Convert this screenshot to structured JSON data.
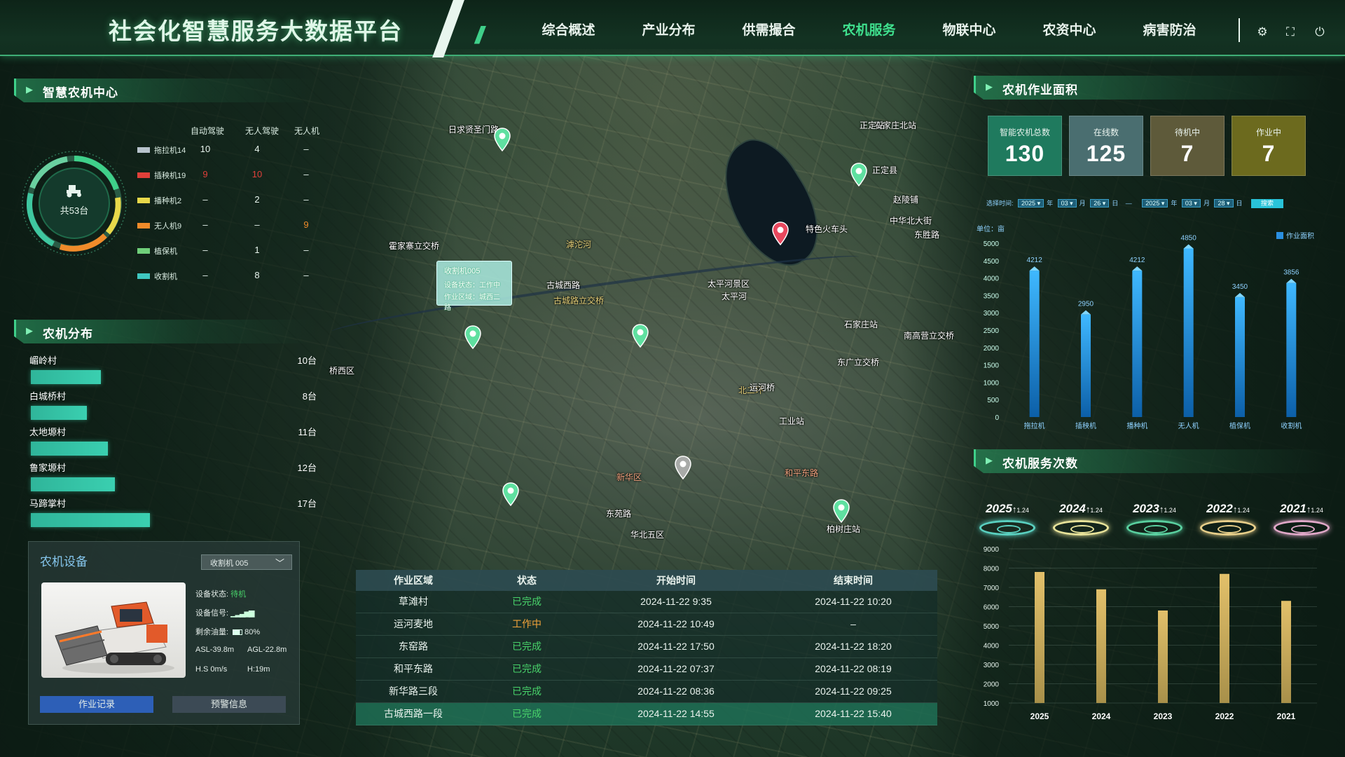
{
  "header": {
    "title": "社会化智慧服务大数据平台",
    "slashes": "//",
    "nav": [
      "综合概述",
      "产业分布",
      "供需撮合",
      "农机服务",
      "物联中心",
      "农资中心",
      "病害防治"
    ],
    "active_index": 3
  },
  "map": {
    "labels": [
      "日求贤圣门路",
      "石家庄北站",
      "石家庄站",
      "新华区",
      "太平河景区",
      "特色火车头",
      "和平东路",
      "北二环",
      "桥西区",
      "工业站",
      "运河桥",
      "东胜路",
      "太平河",
      "华北五区",
      "东广立交桥",
      "霍家寨立交桥",
      "南高营立交桥",
      "正定县",
      "正定站",
      "柏树庄站",
      "古城西路",
      "古城路立交桥",
      "滹沱河",
      "东苑路",
      "中华北大街",
      "赵陵铺"
    ],
    "popup": {
      "title": "收割机005",
      "status_label": "设备状态：",
      "status_value": "工作中",
      "area_label": "作业区域：",
      "area_value": "城西二路"
    }
  },
  "left": {
    "center_title": "智慧农机中心",
    "gauge_total": "共53台",
    "machine_headers": [
      "自动驾驶",
      "无人驾驶",
      "无人机"
    ],
    "machines": [
      {
        "name": "拖拉机14",
        "color": "#b7c3cc",
        "vals": [
          "10",
          "4",
          "–"
        ]
      },
      {
        "name": "插秧机19",
        "color": "#e0403a",
        "vals": [
          "9",
          "10",
          "–"
        ]
      },
      {
        "name": "播种机2",
        "color": "#e8d84a",
        "vals": [
          "–",
          "2",
          "–"
        ]
      },
      {
        "name": "无人机9",
        "color": "#f08b2a",
        "vals": [
          "–",
          "–",
          "9"
        ]
      },
      {
        "name": "植保机",
        "color": "#6fcf7a",
        "vals": [
          "–",
          "1",
          "–"
        ]
      },
      {
        "name": "收割机",
        "color": "#3fc7c0",
        "vals": [
          "–",
          "8",
          "–"
        ]
      }
    ],
    "dist_title": "农机分布",
    "distribution": [
      {
        "name": "嵋岭村",
        "count": "10台",
        "value": 10
      },
      {
        "name": "白城桥村",
        "count": "8台",
        "value": 8
      },
      {
        "name": "太地塬村",
        "count": "11台",
        "value": 11
      },
      {
        "name": "鲁家塬村",
        "count": "12台",
        "value": 12
      },
      {
        "name": "马蹄掌村",
        "count": "17台",
        "value": 17
      }
    ],
    "device": {
      "title": "农机设备",
      "select": "收割机 005",
      "status_label": "设备状态:",
      "status_value": "待机",
      "signal_label": "设备信号:",
      "fuel_label": "剩余油量:",
      "fuel_value": "80%",
      "asl": "ASL-39.8m",
      "agl": "AGL-22.8m",
      "hs": "H.S 0m/s",
      "h": "H:19m",
      "btn_record": "作业记录",
      "btn_warn": "预警信息"
    }
  },
  "right": {
    "area_title": "农机作业面积",
    "stats": [
      {
        "label": "智能农机总数",
        "value": "130",
        "color": "#1f7a5e"
      },
      {
        "label": "在线数",
        "value": "125",
        "color": "#4a6e70"
      },
      {
        "label": "待机中",
        "value": "7",
        "color": "#5e5a3a"
      },
      {
        "label": "作业中",
        "value": "7",
        "color": "#6c6a1e"
      }
    ],
    "filter": {
      "label": "选择时间:",
      "y1": "2025",
      "m1": "03",
      "d1": "26",
      "y2": "2025",
      "m2": "03",
      "d2": "28",
      "year": "年",
      "month": "月",
      "day": "日",
      "dash": "—",
      "search": "搜索"
    },
    "service_title": "农机服务次数",
    "years": [
      {
        "year": "2025",
        "delta": "1.24",
        "color": "#5ad0c0"
      },
      {
        "year": "2024",
        "delta": "1.24",
        "color": "#e8e39a"
      },
      {
        "year": "2023",
        "delta": "1.24",
        "color": "#5ad0a0"
      },
      {
        "year": "2022",
        "delta": "1.24",
        "color": "#e8cf8a"
      },
      {
        "year": "2021",
        "delta": "1.24",
        "color": "#e0a8c8"
      }
    ]
  },
  "chart_data": [
    {
      "type": "bar",
      "unit": "单位：亩",
      "legend": "作业面积",
      "categories": [
        "拖拉机",
        "插秧机",
        "播种机",
        "无人机",
        "植保机",
        "收割机"
      ],
      "values": [
        4212,
        2950,
        4212,
        4850,
        3450,
        3856
      ],
      "ylim": [
        0,
        5000
      ],
      "yticks": [
        0,
        500,
        1000,
        1500,
        2000,
        2500,
        3000,
        3500,
        4000,
        4500,
        5000
      ]
    },
    {
      "type": "bar",
      "categories": [
        "2025",
        "2024",
        "2023",
        "2022",
        "2021"
      ],
      "values": [
        7800,
        6900,
        5800,
        7700,
        6300
      ],
      "ylim": [
        1000,
        9000
      ],
      "yticks": [
        1000,
        2000,
        3000,
        4000,
        5000,
        6000,
        7000,
        8000,
        9000
      ]
    }
  ],
  "table": {
    "headers": [
      "作业区域",
      "状态",
      "开始时间",
      "结束时间"
    ],
    "rows": [
      [
        "草滩村",
        "已完成",
        "2024-11-22  9:35",
        "2024-11-22  10:20"
      ],
      [
        "运河麦地",
        "工作中",
        "2024-11-22  10:49",
        "–"
      ],
      [
        "东窑路",
        "已完成",
        "2024-11-22  17:50",
        "2024-11-22  18:20"
      ],
      [
        "和平东路",
        "已完成",
        "2024-11-22  07:37",
        "2024-11-22  08:19"
      ],
      [
        "新华路三段",
        "已完成",
        "2024-11-22  08:36",
        "2024-11-22  09:25"
      ],
      [
        "古城西路一段",
        "已完成",
        "2024-11-22  14:55",
        "2024-11-22  15:40"
      ]
    ]
  }
}
